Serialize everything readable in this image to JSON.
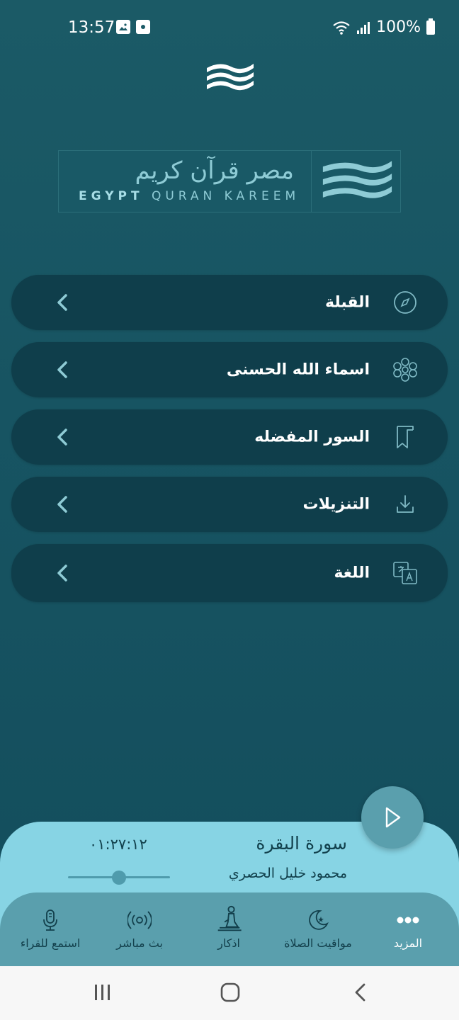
{
  "status_bar": {
    "time": "13:57",
    "battery": "100%"
  },
  "banner": {
    "arabic_title": "مصر قرآن كريم",
    "english_word1": "EGYPT",
    "english_rest": "QURAN KAREEM"
  },
  "menu": {
    "items": [
      {
        "label": "القبلة",
        "icon": "compass-icon"
      },
      {
        "label": "اسماء الله الحسنى",
        "icon": "ornament-icon"
      },
      {
        "label": "السور المفضله",
        "icon": "bookmark-icon"
      },
      {
        "label": "التنزيلات",
        "icon": "download-icon"
      },
      {
        "label": "اللغة",
        "icon": "translate-icon"
      }
    ]
  },
  "player": {
    "surah": "سورة البقرة",
    "reciter": "محمود خليل الحصري",
    "time": "٠١:٢٧:١٢",
    "progress": 0.5
  },
  "bottom_nav": {
    "items": [
      {
        "label": "المزيد",
        "icon": "more-dots-icon",
        "active": true
      },
      {
        "label": "مواقيت الصلاة",
        "icon": "crescent-icon",
        "active": false
      },
      {
        "label": "اذكار",
        "icon": "praying-person-icon",
        "active": false
      },
      {
        "label": "بث مباشر",
        "icon": "broadcast-icon",
        "active": false
      },
      {
        "label": "استمع للقراء",
        "icon": "microphone-icon",
        "active": false
      }
    ]
  },
  "colors": {
    "background": "#1b5a66",
    "menu_item": "#0f3e4b",
    "player": "#87d4e4",
    "nav": "#5a9fad",
    "accent": "#8ecbd5"
  }
}
